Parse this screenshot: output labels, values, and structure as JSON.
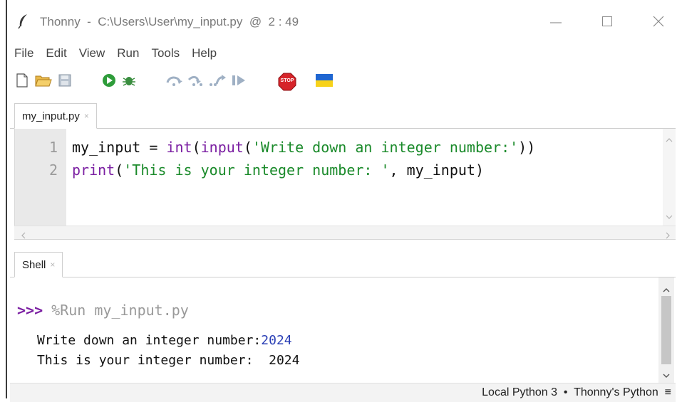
{
  "window": {
    "title": "Thonny  -  C:\\Users\\User\\my_input.py  @  2 : 49",
    "minimize_glyph": "—",
    "maximize_glyph": "☐",
    "close_glyph": "✕"
  },
  "menu": [
    {
      "label": "File"
    },
    {
      "label": "Edit"
    },
    {
      "label": "View"
    },
    {
      "label": "Run"
    },
    {
      "label": "Tools"
    },
    {
      "label": "Help"
    }
  ],
  "toolbar": {
    "icons": [
      "new-file-icon",
      "open-folder-icon",
      "save-icon",
      "run-icon",
      "debug-icon",
      "step-over-icon",
      "step-into-icon",
      "step-out-icon",
      "resume-icon",
      "stop-icon",
      "ukraine-flag-icon"
    ],
    "stop_label": "STOP"
  },
  "editor": {
    "tab_label": "my_input.py",
    "tab_close": "×",
    "line_numbers": [
      "1",
      "2"
    ],
    "line1": {
      "var": "my_input",
      "op": " = ",
      "fn1": "int",
      "p1": "(",
      "fn2": "input",
      "p2": "(",
      "str": "'Write down an integer number:'",
      "p3": "))"
    },
    "line2": {
      "fn": "print",
      "p1": "(",
      "str": "'This is your integer number: '",
      "rest": ", my_input",
      "p2": ")"
    }
  },
  "shell": {
    "tab_label": "Shell",
    "tab_close": "×",
    "prompt": ">>>",
    "command": " %Run my_input.py",
    "output1_text": "Write down an integer number:",
    "output1_input": "2024",
    "output2": "This is your integer number:  2024"
  },
  "status": {
    "text": "Local Python 3  •  Thonny's Python  ≡"
  },
  "colors": {
    "keyword_builtin": "#7b1fa2",
    "string": "#1a8a2a",
    "user_input": "#2a3fb5",
    "gutter_bg": "#e9e9e9"
  }
}
